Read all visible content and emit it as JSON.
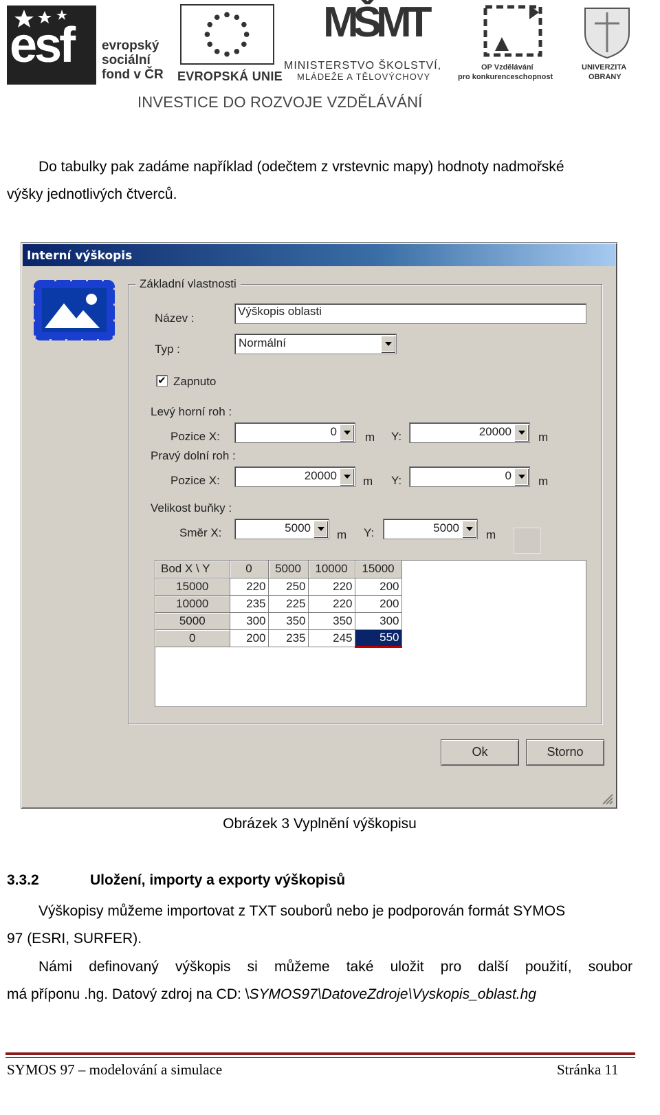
{
  "logos": {
    "esf": {
      "mark": "esf",
      "text": [
        "evropský",
        "sociální",
        "fond v ČR"
      ]
    },
    "eu": {
      "text": "EVROPSKÁ UNIE"
    },
    "msmt": {
      "mark": "MŠMT",
      "line1": "MINISTERSTVO ŠKOLSTVÍ,",
      "line2": "MLÁDEŽE A TĚLOVÝCHOVY"
    },
    "op": {
      "line1": "OP Vzdělávání",
      "line2": "pro konkurenceschopnost"
    },
    "uo": {
      "line1": "UNIVERZITA",
      "line2": "OBRANY"
    },
    "banner": "INVESTICE DO ROZVOJE VZDĚLÁVÁNÍ"
  },
  "intro": {
    "line1": "Do tabulky pak zadáme například (odečtem z vrstevnic mapy) hodnoty nadmořské",
    "line2": "výšky jednotlivých čtverců."
  },
  "dialog": {
    "title": "Interní výškopis",
    "group_label": "Základní vlastnosti",
    "name_label": "Název :",
    "name_value": "Výškopis oblasti",
    "type_label": "Typ :",
    "type_value": "Normální",
    "enabled_label": "Zapnuto",
    "enabled_checked": "✔",
    "top_left_label": "Levý horní roh :",
    "bottom_right_label": "Pravý dolní roh :",
    "cell_size_label": "Velikost buňky :",
    "pos_x_label": "Pozice X:",
    "y_label": "Y:",
    "dir_x_label": "Směr X:",
    "unit": "m",
    "top_left": {
      "x": "0",
      "y": "20000"
    },
    "bottom_right": {
      "x": "20000",
      "y": "0"
    },
    "cell_size": {
      "x": "5000",
      "y": "5000"
    },
    "grid": {
      "corner": "Bod  X \\ Y",
      "columns": [
        "0",
        "5000",
        "10000",
        "15000"
      ],
      "rows": [
        {
          "label": "15000",
          "values": [
            "220",
            "250",
            "220",
            "200"
          ]
        },
        {
          "label": "10000",
          "values": [
            "235",
            "225",
            "220",
            "200"
          ]
        },
        {
          "label": "5000",
          "values": [
            "300",
            "350",
            "350",
            "300"
          ]
        },
        {
          "label": "0",
          "values": [
            "200",
            "235",
            "245",
            "550"
          ]
        }
      ]
    },
    "ok_label": "Ok",
    "cancel_label": "Storno"
  },
  "caption": "Obrázek 3 Vyplnění výškopisu",
  "section": {
    "number": "3.3.2",
    "title": "Uložení, importy a exporty výškopisů"
  },
  "para2": {
    "line1": "Výškopisy můžeme importovat z TXT souborů nebo je podporován formát SYMOS",
    "line2": "97 (ESRI, SURFER)."
  },
  "para3": {
    "line1": "Námi definovaný výškopis si můžeme také uložit pro další použití, soubor",
    "line2_prefix": "má příponu .hg. Datový zdroj na CD: \\",
    "line2_italic": "SYMOS97\\DatoveZdroje\\Vyskopis_oblast.hg"
  },
  "footer": {
    "left": "SYMOS 97 – modelování a simulace",
    "right": "Stránka 11"
  },
  "colors": {
    "titlebar": "#0a246a",
    "dialog_bg": "#d4d0c8",
    "footer_rule": "#8b1c1c",
    "selection": "#0a246a"
  }
}
